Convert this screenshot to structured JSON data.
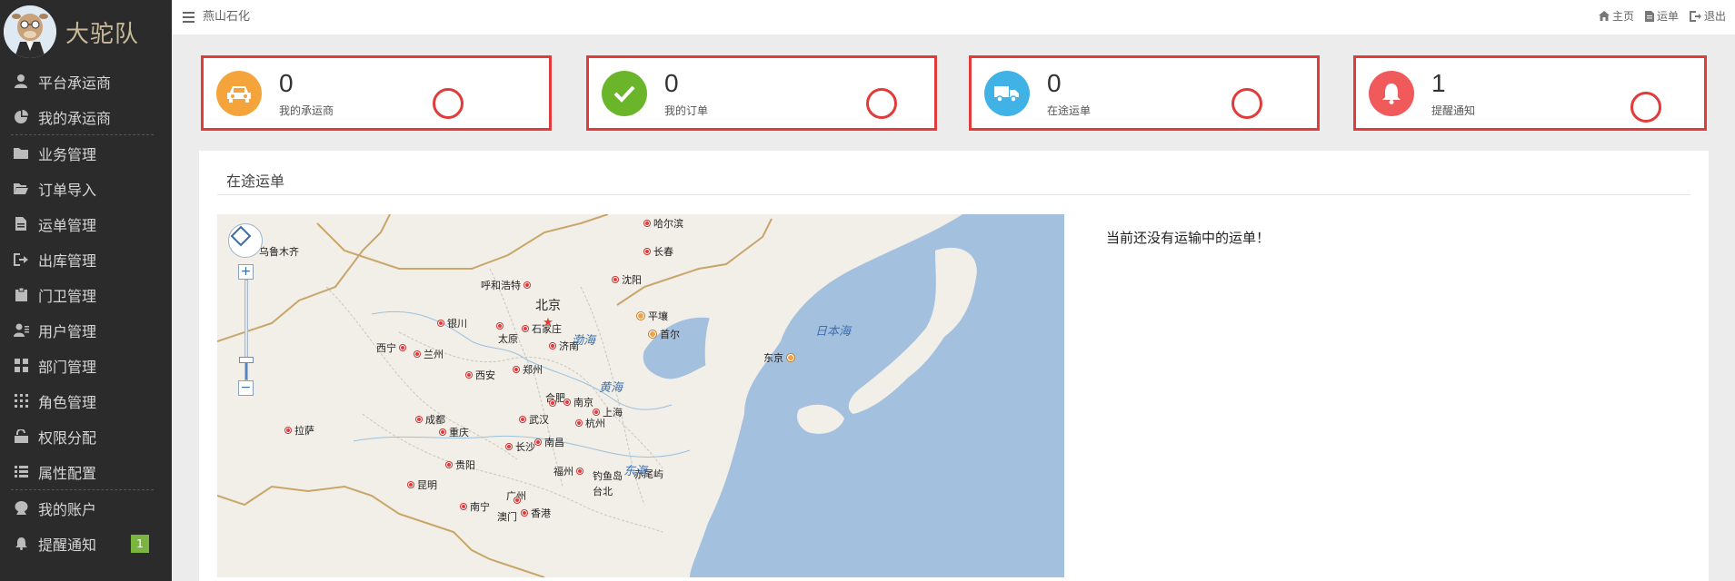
{
  "sidebar": {
    "brand": "大驼队",
    "items": [
      {
        "label": "平台承运商",
        "icon": "user-icon"
      },
      {
        "label": "我的承运商",
        "icon": "pie-chart-icon"
      },
      {
        "label": "业务管理",
        "icon": "folder-icon"
      },
      {
        "label": "订单导入",
        "icon": "folder-open-icon"
      },
      {
        "label": "运单管理",
        "icon": "document-icon"
      },
      {
        "label": "出库管理",
        "icon": "sign-out-icon"
      },
      {
        "label": "门卫管理",
        "icon": "clipboard-icon"
      },
      {
        "label": "用户管理",
        "icon": "users-icon"
      },
      {
        "label": "部门管理",
        "icon": "grid-icon"
      },
      {
        "label": "角色管理",
        "icon": "dots-grid-icon"
      },
      {
        "label": "权限分配",
        "icon": "unlock-icon"
      },
      {
        "label": "属性配置",
        "icon": "list-icon"
      },
      {
        "label": "我的账户",
        "icon": "account-icon"
      },
      {
        "label": "提醒通知",
        "icon": "bell-icon",
        "badge": "1"
      }
    ]
  },
  "topbar": {
    "company": "燕山石化",
    "links": [
      {
        "label": "主页",
        "icon": "home-icon"
      },
      {
        "label": "运单",
        "icon": "file-icon"
      },
      {
        "label": "退出",
        "icon": "logout-icon"
      }
    ]
  },
  "stats": [
    {
      "value": "0",
      "label": "我的承运商",
      "color": "#f5a43b",
      "icon": "car-icon"
    },
    {
      "value": "0",
      "label": "我的订单",
      "color": "#6bb52b",
      "icon": "check-icon"
    },
    {
      "value": "0",
      "label": "在途运单",
      "color": "#41b2e6",
      "icon": "truck-icon"
    },
    {
      "value": "1",
      "label": "提醒通知",
      "color": "#f15a5a",
      "icon": "bell-icon"
    }
  ],
  "panel": {
    "title": "在途运单",
    "empty_message": "当前还没有运输中的运单！"
  },
  "map": {
    "zoom_level": 0.2,
    "capital": "北京",
    "cities": [
      "哈尔滨",
      "乌鲁木齐",
      "长春",
      "沈阳",
      "呼和浩特",
      "平壤",
      "首尔",
      "银川",
      "石家庄",
      "太原",
      "济南",
      "西宁",
      "兰州",
      "郑州",
      "西安",
      "东京",
      "合肥",
      "南京",
      "上海",
      "成都",
      "武汉",
      "杭州",
      "拉萨",
      "重庆",
      "长沙",
      "南昌",
      "贵阳",
      "福州",
      "钓鱼岛",
      "赤尾屿",
      "昆明",
      "台北",
      "广州",
      "南宁",
      "澳门",
      "香港"
    ],
    "seas": [
      "渤海",
      "日本海",
      "黄海",
      "东海"
    ]
  }
}
